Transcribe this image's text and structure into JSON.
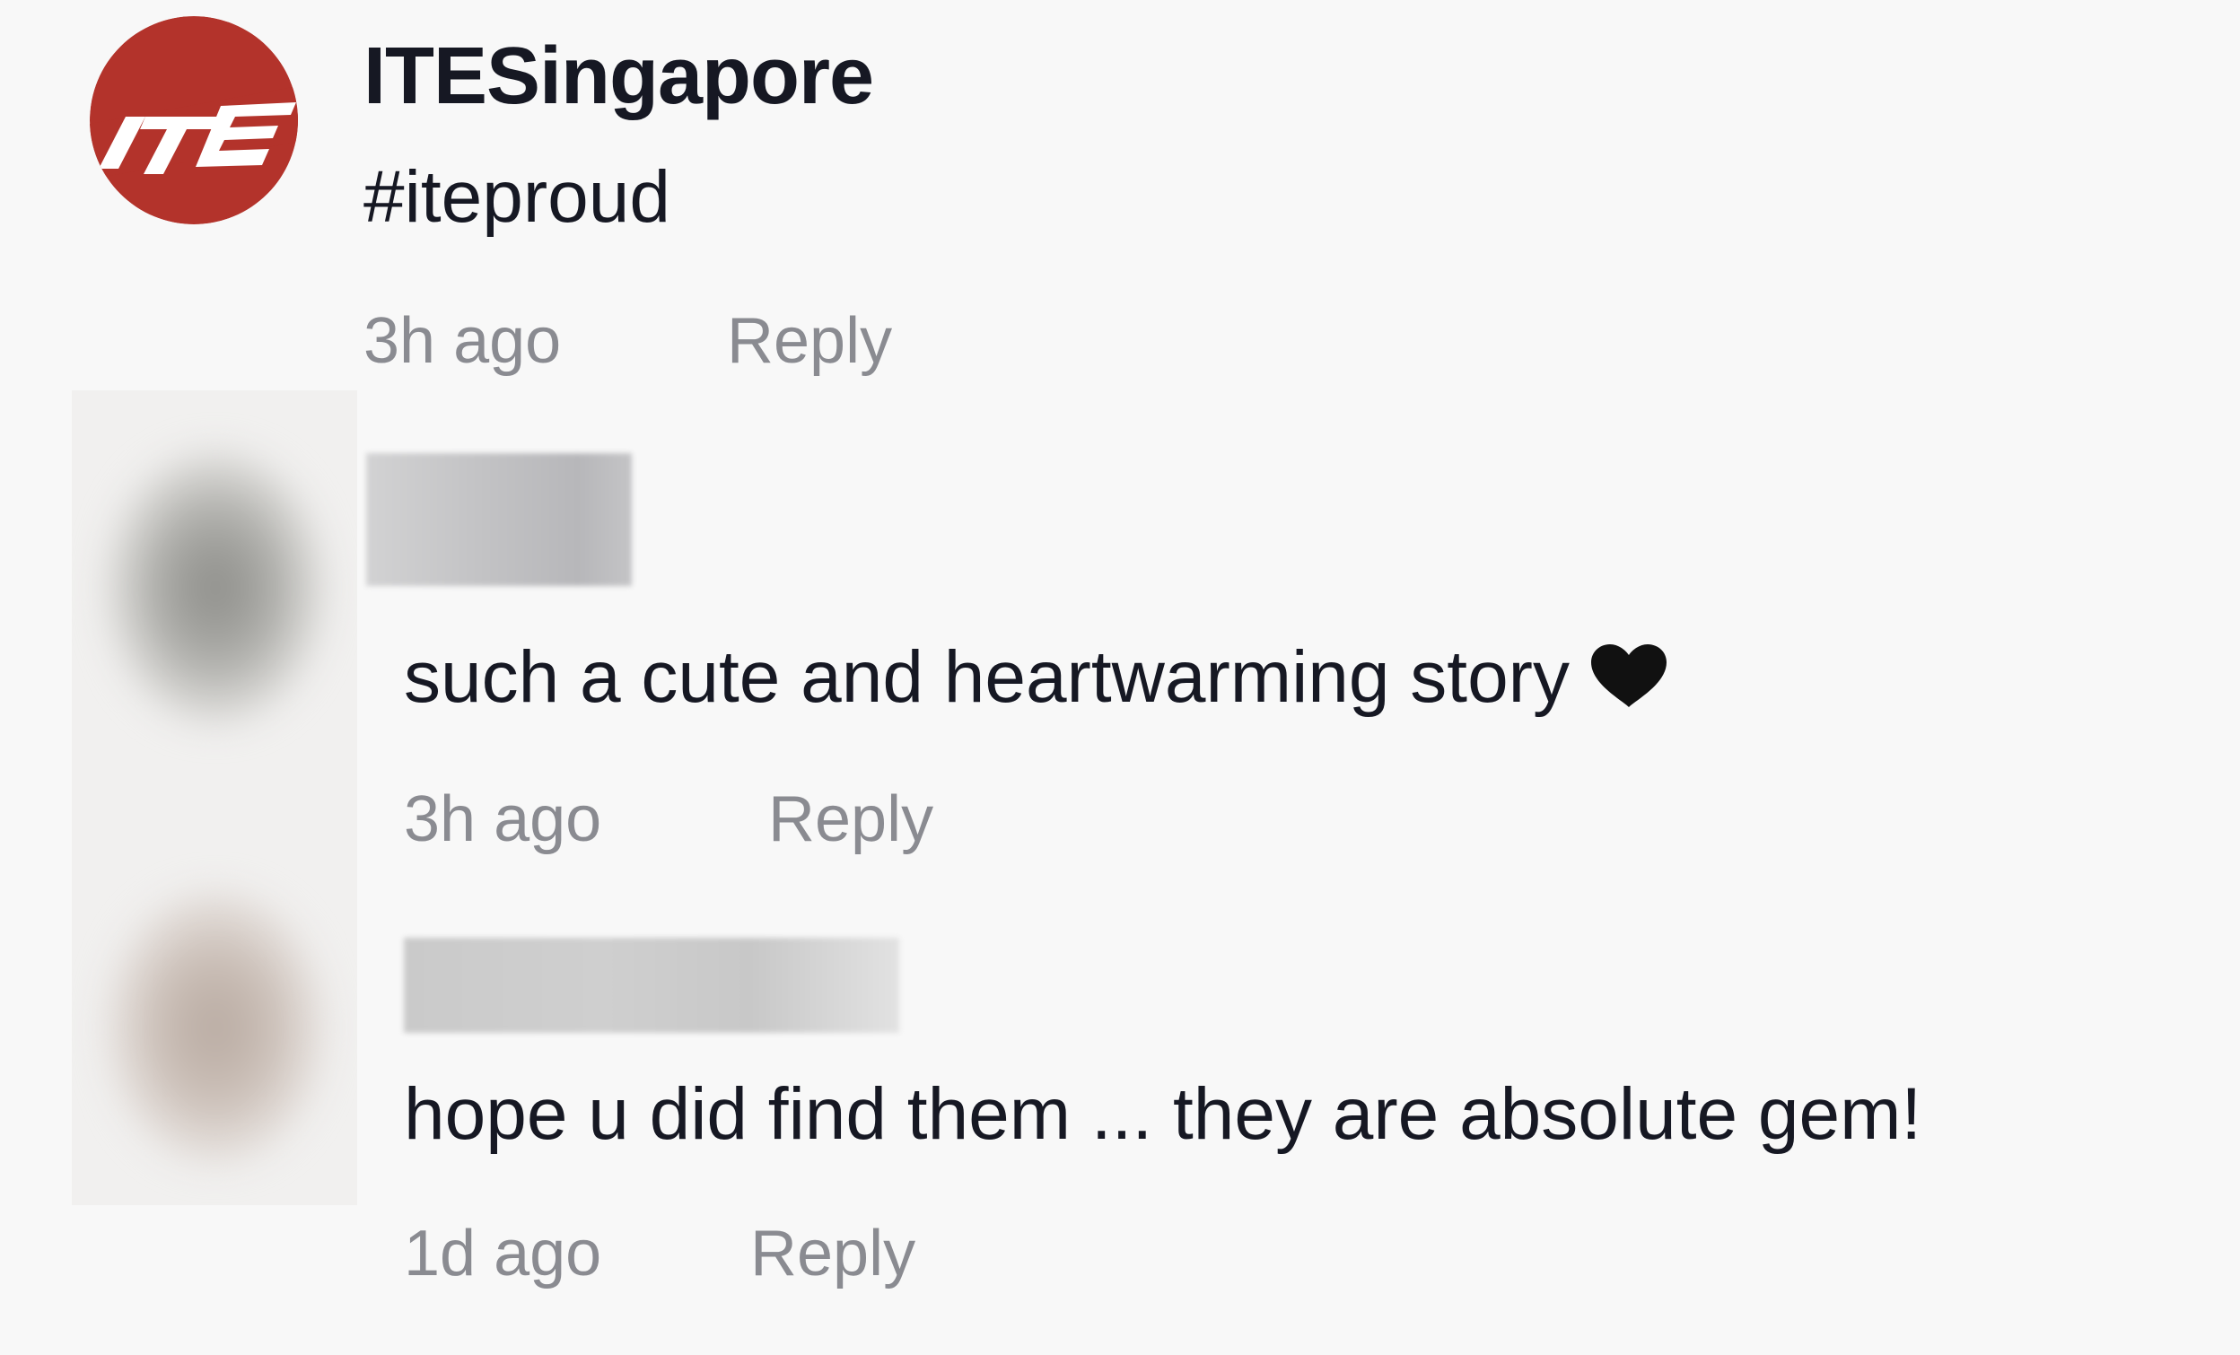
{
  "comment": {
    "username": "ITESingapore",
    "avatar_logo_text": "ITE",
    "avatar_color": "#b3332b",
    "text": "#iteproud",
    "time": "3h ago",
    "reply_label": "Reply"
  },
  "replies": [
    {
      "username_redacted": true,
      "text": "such a cute and heartwarming story",
      "trailing_icon": "heart-icon",
      "time": "3h ago",
      "reply_label": "Reply"
    },
    {
      "username_redacted": true,
      "text": "hope u did find them ... they are absolute gem!",
      "time": "1d ago",
      "reply_label": "Reply"
    }
  ]
}
